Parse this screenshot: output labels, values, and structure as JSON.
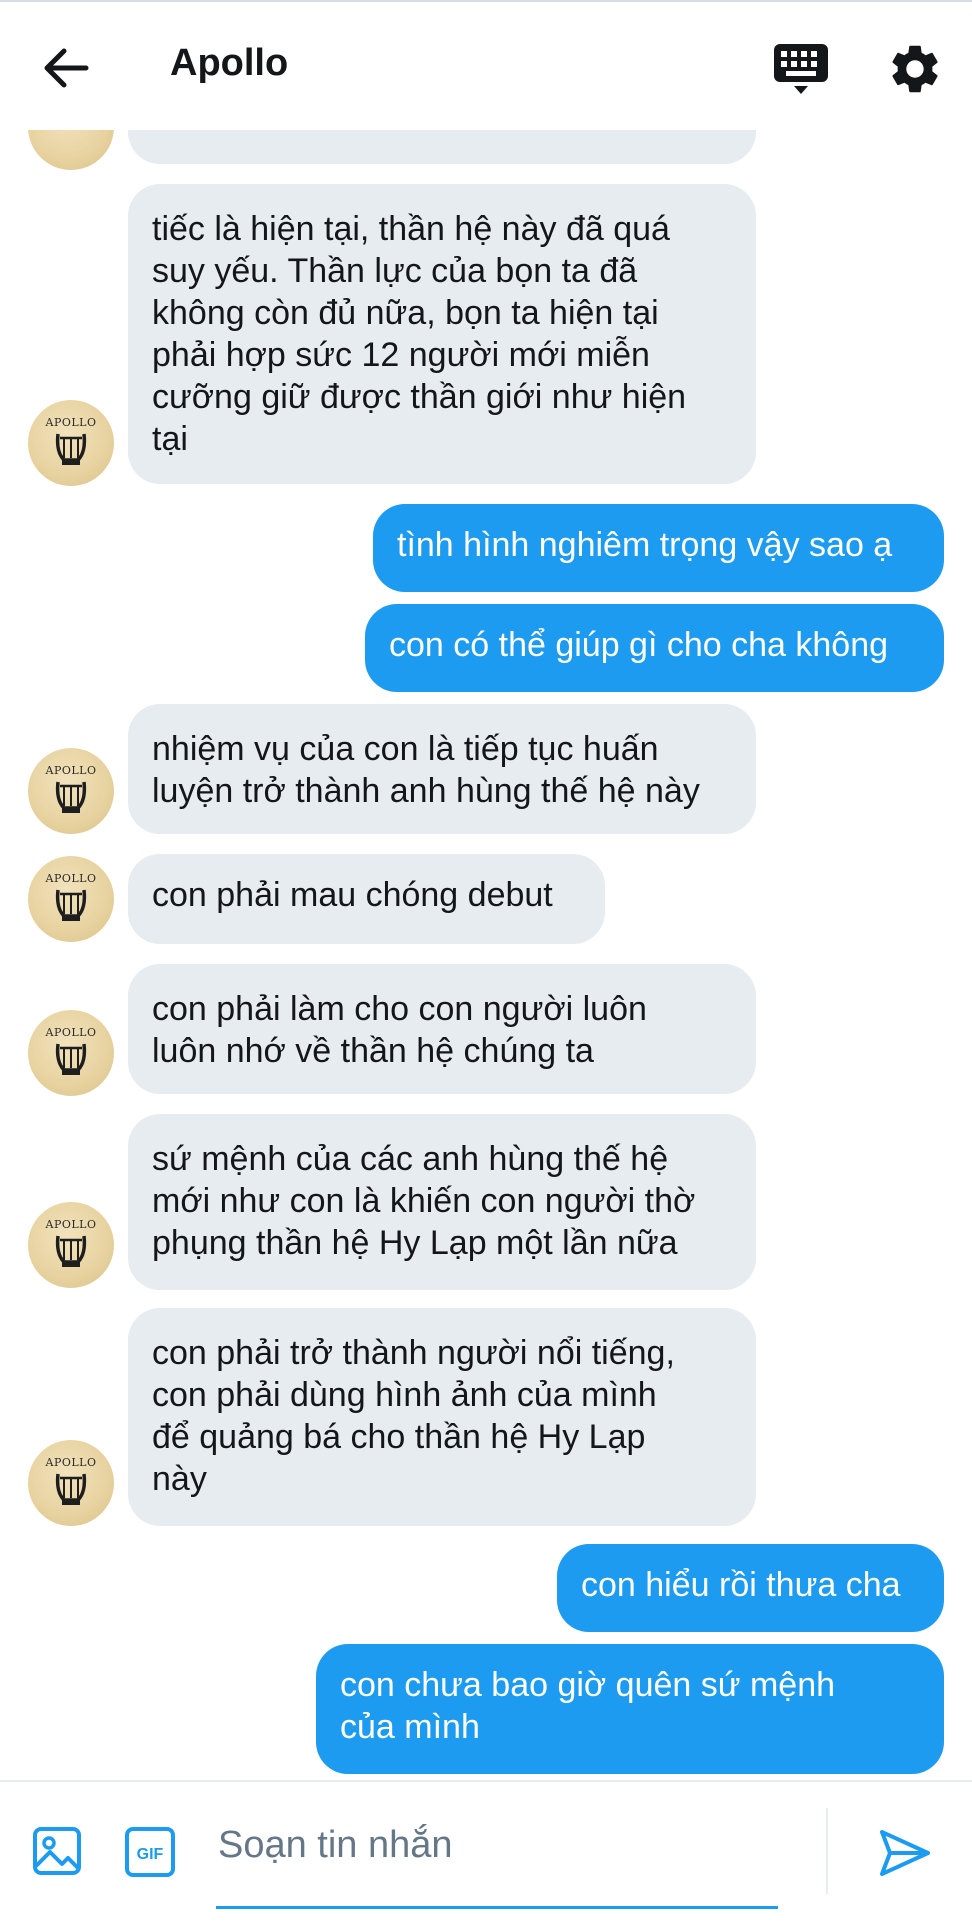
{
  "header": {
    "title": "Apollo",
    "icons": [
      "back-arrow-icon",
      "keyboard-icon",
      "gear-icon"
    ]
  },
  "avatar_label": "APOLLO",
  "messages": [
    {
      "from": "them",
      "text": "...",
      "partial": true
    },
    {
      "from": "them",
      "text": "tiếc là hiện tại, thần hệ này đã quá\nsuy yếu. Thần lực của bọn ta đã\nkhông còn đủ nữa, bọn ta hiện tại\nphải hợp sức 12 người mới miễn\ncưỡng giữ được thần giới như hiện\ntại"
    },
    {
      "from": "me",
      "text": "tình hình nghiêm trọng vậy sao ạ"
    },
    {
      "from": "me",
      "text": "con có thể giúp gì cho cha không"
    },
    {
      "from": "them",
      "text": "nhiệm vụ của con là tiếp tục huấn\nluyện trở thành anh hùng thế hệ này"
    },
    {
      "from": "them",
      "text": "con phải mau chóng debut"
    },
    {
      "from": "them",
      "text": "con phải làm cho con người luôn\nluôn nhớ về thần hệ chúng ta"
    },
    {
      "from": "them",
      "text": "sứ mệnh của các anh hùng thế hệ\nmới như con là khiến con người thờ\nphụng thần hệ Hy Lạp một lần nữa"
    },
    {
      "from": "them",
      "text": "con phải trở thành người nổi tiếng,\ncon phải dùng hình ảnh của mình\nđể quảng bá cho thần hệ Hy Lạp\nnày"
    },
    {
      "from": "me",
      "text": "con hiểu rồi thưa cha"
    },
    {
      "from": "me",
      "text": "con chưa bao giờ quên sứ mệnh\ncủa mình"
    }
  ],
  "composer": {
    "placeholder": "Soạn tin nhắn",
    "icons": [
      "image-icon",
      "gif-icon",
      "send-icon"
    ]
  },
  "colors": {
    "outgoing_bubble": "#1d9bf0",
    "incoming_bubble": "#e6ecf0",
    "accent": "#1d9bf0"
  }
}
